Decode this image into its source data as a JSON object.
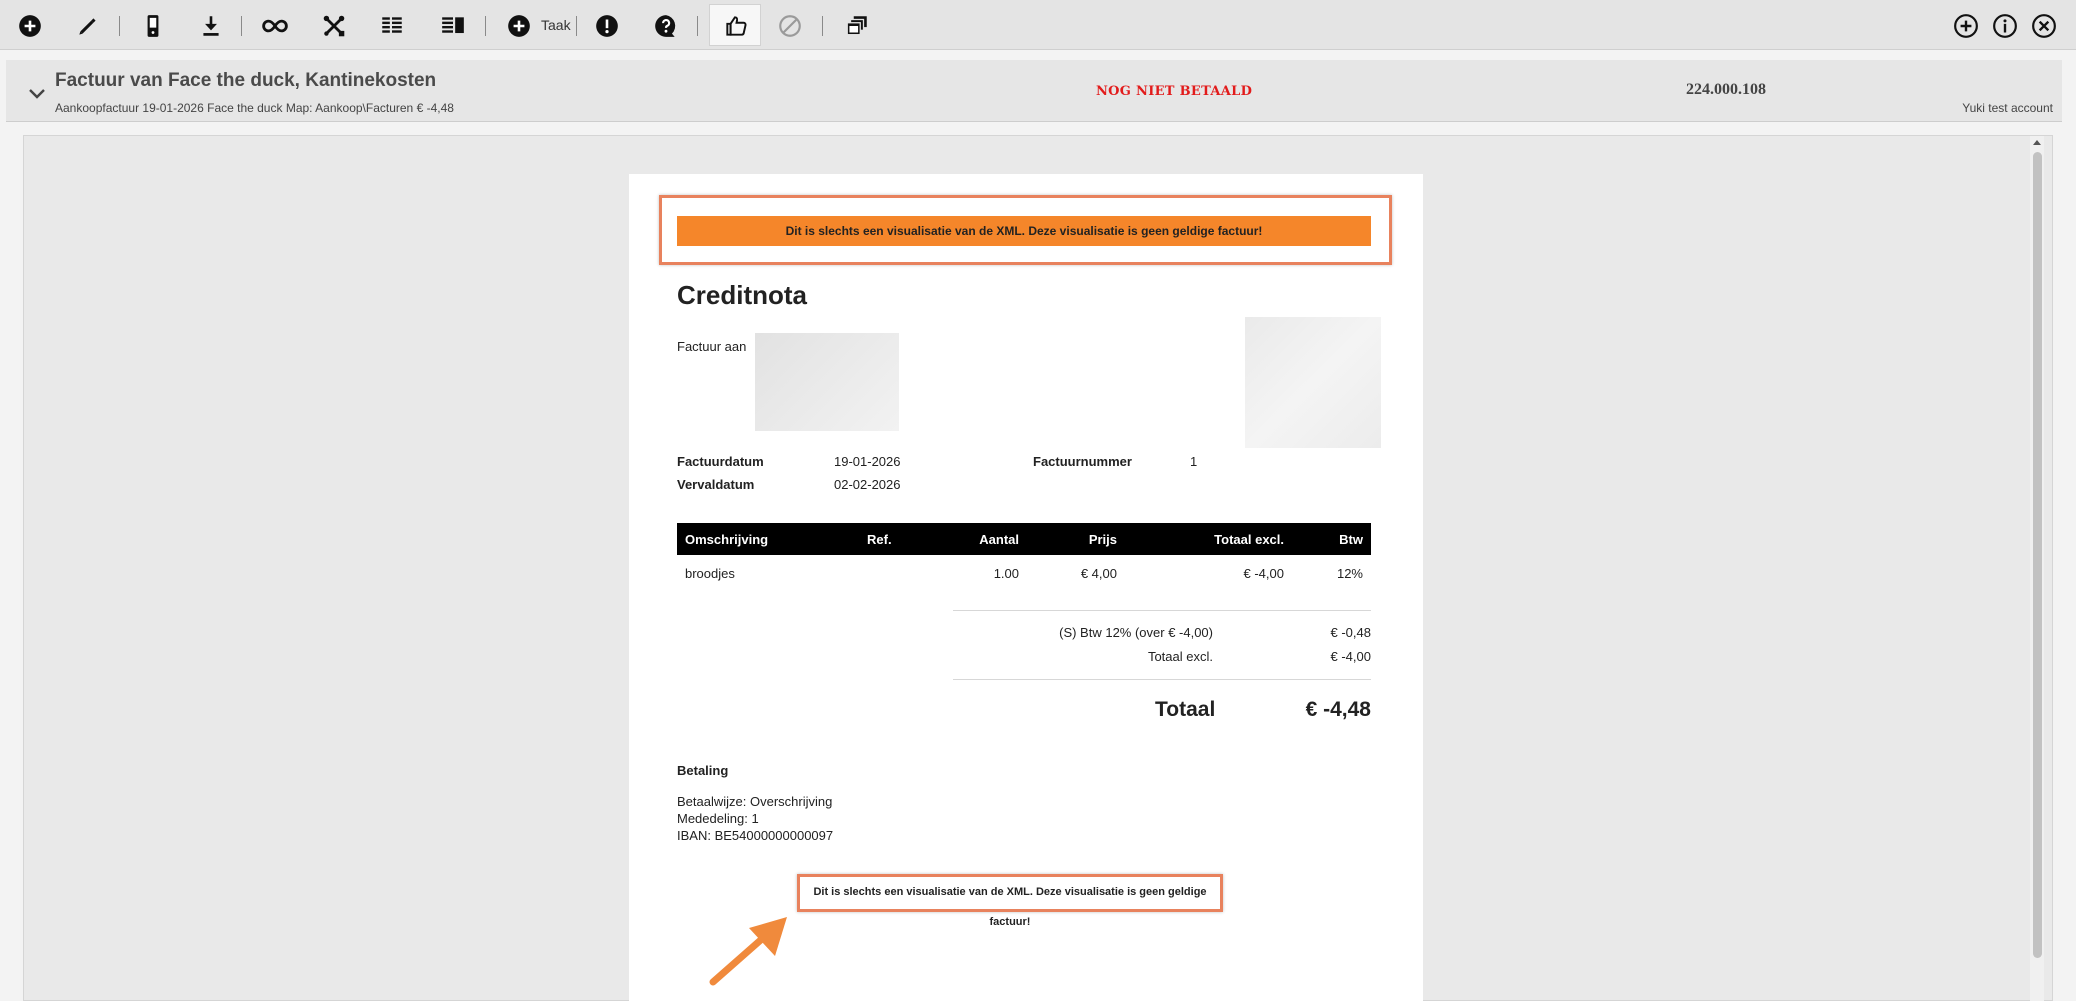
{
  "toolbar": {
    "task_label": "Taak"
  },
  "header": {
    "title": "Factuur van Face the duck, Kantinekosten",
    "subtitle": "Aankoopfactuur 19-01-2026 Face the duck Map: Aankoop\\Facturen € -4,48",
    "status": "NOG NIET BETAALD",
    "number": "224.000.108",
    "account": "Yuki test account"
  },
  "document": {
    "warning": "Dit is slechts een visualisatie van de XML. Deze visualisatie is geen geldige factuur!",
    "title": "Creditnota",
    "bill_to_label": "Factuur aan",
    "invoice_date_label": "Factuurdatum",
    "invoice_date": "19-01-2026",
    "due_date_label": "Vervaldatum",
    "due_date": "02-02-2026",
    "invoice_number_label": "Factuurnummer",
    "invoice_number": "1",
    "table": {
      "headers": [
        "Omschrijving",
        "Ref.",
        "Aantal",
        "Prijs",
        "Totaal excl.",
        "Btw"
      ],
      "rows": [
        [
          "broodjes",
          "",
          "1.00",
          "€ 4,00",
          "€ -4,00",
          "12%"
        ]
      ]
    },
    "summary": {
      "vat_label": "(S) Btw 12% (over € -4,00)",
      "vat_value": "€ -0,48",
      "total_excl_label": "Totaal excl.",
      "total_excl_value": "€ -4,00",
      "total_label": "Totaal",
      "total_value": "€ -4,48"
    },
    "payment": {
      "title": "Betaling",
      "method": "Betaalwijze: Overschrijving",
      "reference": "Mededeling: 1",
      "iban": "IBAN: BE54000000000097"
    },
    "warning_footer": "Dit is slechts een visualisatie van de XML. Deze visualisatie is geen geldige factuur!"
  },
  "colors": {
    "warning_bar": "#f5862a",
    "highlight_border": "#e8825d",
    "status_red": "#e21b1b",
    "table_header": "#000000"
  }
}
